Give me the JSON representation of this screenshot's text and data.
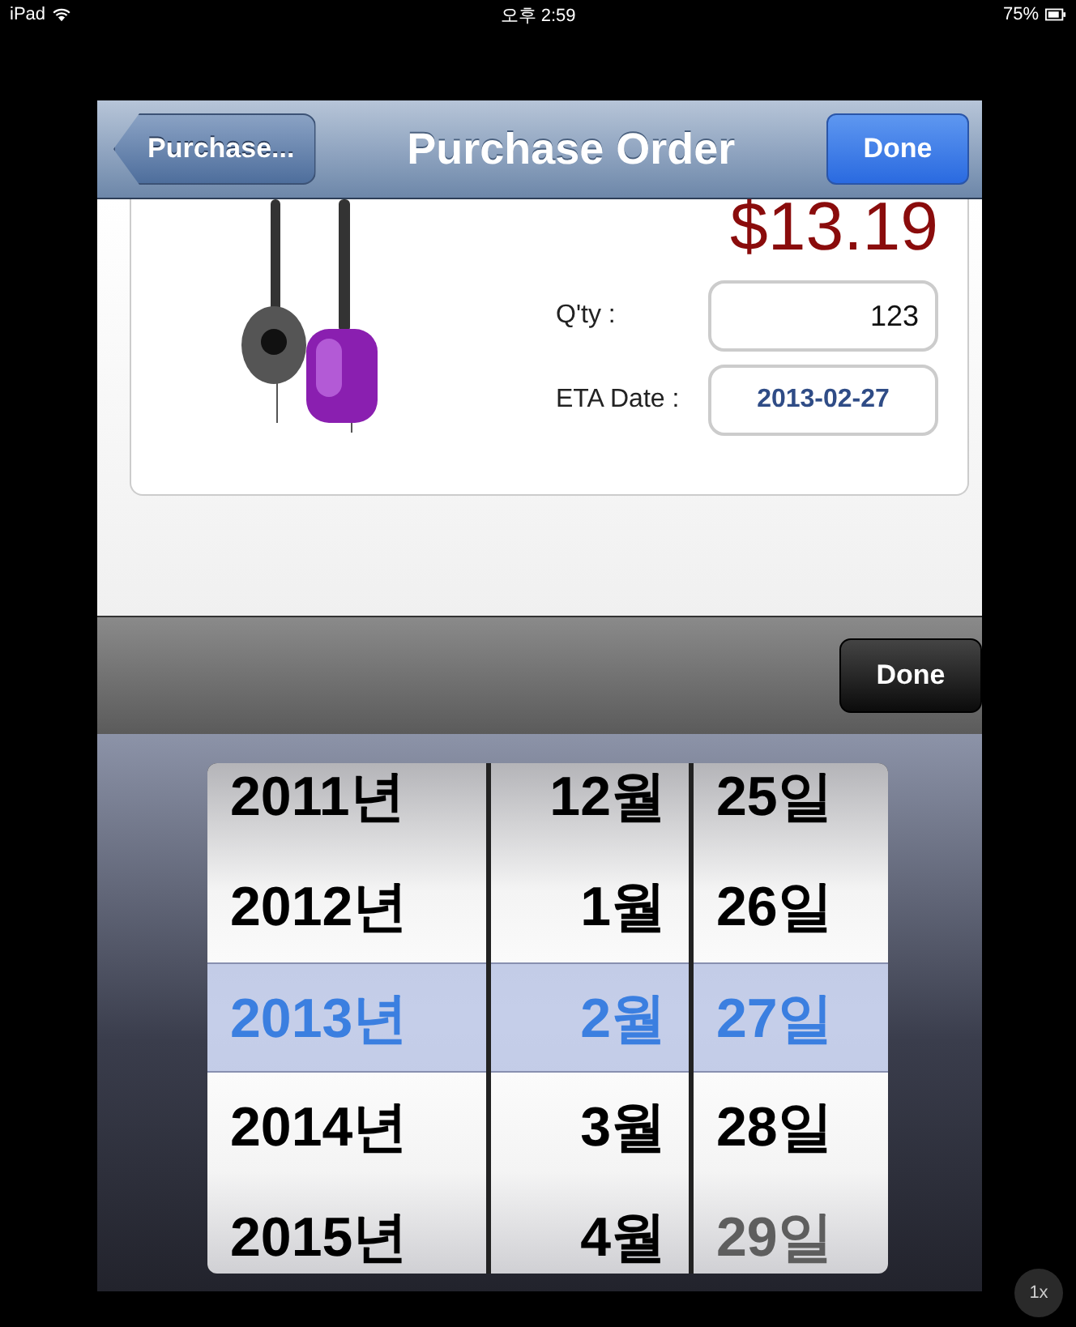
{
  "status_bar": {
    "device": "iPad",
    "time": "오후 2:59",
    "battery": "75%"
  },
  "nav_bar": {
    "back": "Purchase...",
    "title": "Purchase Order",
    "done": "Done"
  },
  "item": {
    "price": "$13.19",
    "fields": [
      {
        "label": "Q'ty :",
        "value": "123",
        "kind": "number"
      },
      {
        "label": "ETA Date :",
        "value": "2013-02-27",
        "kind": "date"
      }
    ]
  },
  "toolbar": {
    "done": "Done"
  },
  "picker": {
    "columns": [
      {
        "kind": "year",
        "items": [
          {
            "label": "2011년",
            "selected": false,
            "disabled": false
          },
          {
            "label": "2012년",
            "selected": false,
            "disabled": false
          },
          {
            "label": "2013년",
            "selected": true,
            "disabled": false
          },
          {
            "label": "2014년",
            "selected": false,
            "disabled": false
          },
          {
            "label": "2015년",
            "selected": false,
            "disabled": false
          }
        ]
      },
      {
        "kind": "month",
        "items": [
          {
            "label": "12월",
            "selected": false,
            "disabled": false
          },
          {
            "label": "1월",
            "selected": false,
            "disabled": false
          },
          {
            "label": "2월",
            "selected": true,
            "disabled": false
          },
          {
            "label": "3월",
            "selected": false,
            "disabled": false
          },
          {
            "label": "4월",
            "selected": false,
            "disabled": false
          }
        ]
      },
      {
        "kind": "day",
        "items": [
          {
            "label": "25일",
            "selected": false,
            "disabled": false
          },
          {
            "label": "26일",
            "selected": false,
            "disabled": false
          },
          {
            "label": "27일",
            "selected": true,
            "disabled": false
          },
          {
            "label": "28일",
            "selected": false,
            "disabled": false
          },
          {
            "label": "29일",
            "selected": false,
            "disabled": true
          }
        ]
      }
    ]
  },
  "zoom_badge": "1x"
}
